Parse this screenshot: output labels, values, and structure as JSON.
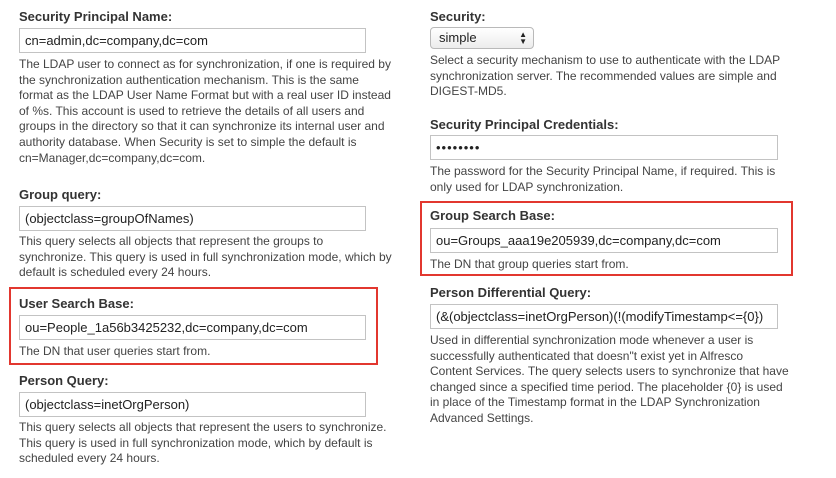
{
  "left": {
    "security_principal_name": {
      "label": "Security Principal Name:",
      "value": "cn=admin,dc=company,dc=com",
      "help_lines": [
        "The LDAP user to connect as for synchronization, if one is required by",
        "the synchronization authentication mechanism. This is the same",
        "format as the LDAP User Name Format but with a real user ID instead",
        "of %s. This account is used to retrieve the details of all users and",
        "groups in the directory so that it can synchronize its internal user and",
        "authority database. When Security is set to simple the default is",
        "cn=Manager,dc=company,dc=com."
      ]
    },
    "group_query": {
      "label": "Group query:",
      "value": "(objectclass=groupOfNames)",
      "help_lines": [
        "This query selects all objects that represent the groups to",
        "synchronize. This query is used in full synchronization mode, which by",
        "default is scheduled every 24 hours."
      ]
    },
    "user_search_base": {
      "label": "User Search Base:",
      "value": "ou=People_1a56b3425232,dc=company,dc=com",
      "help_lines": [
        "The DN that user queries start from."
      ]
    },
    "person_query": {
      "label": "Person Query:",
      "value": "(objectclass=inetOrgPerson)",
      "help_lines": [
        "This query selects all objects that represent the users to synchronize.",
        "This query is used in full synchronization mode, which by default is",
        "scheduled every 24 hours."
      ]
    }
  },
  "right": {
    "security": {
      "label": "Security:",
      "selected": "simple",
      "help_lines": [
        "Select a security mechanism to use to authenticate with the LDAP",
        "synchronization server. The recommended values are simple and",
        "DIGEST-MD5."
      ]
    },
    "security_principal_credentials": {
      "label": "Security Principal Credentials:",
      "value": "••••••••",
      "help_lines": [
        "The password for the Security Principal Name, if required. This is",
        "only used for LDAP synchronization."
      ]
    },
    "group_search_base": {
      "label": "Group Search Base:",
      "value": "ou=Groups_aaa19e205939,dc=company,dc=com",
      "help_lines": [
        "The DN that group queries start from."
      ]
    },
    "person_differential_query": {
      "label": "Person Differential Query:",
      "value": "(&(objectclass=inetOrgPerson)(!(modifyTimestamp<={0})",
      "help_lines": [
        "Used in differential synchronization mode whenever a user is",
        "successfully authenticated that doesn\"t exist yet in Alfresco",
        "Content Services. The query selects users to synchronize that have",
        "changed since a specified time period. The placeholder {0} is used",
        "in place of the Timestamp format in the LDAP Synchronization",
        "Advanced Settings."
      ]
    }
  },
  "colors": {
    "highlight": "#e2372f",
    "input_border": "#c3c3c3",
    "text": "#333333"
  }
}
